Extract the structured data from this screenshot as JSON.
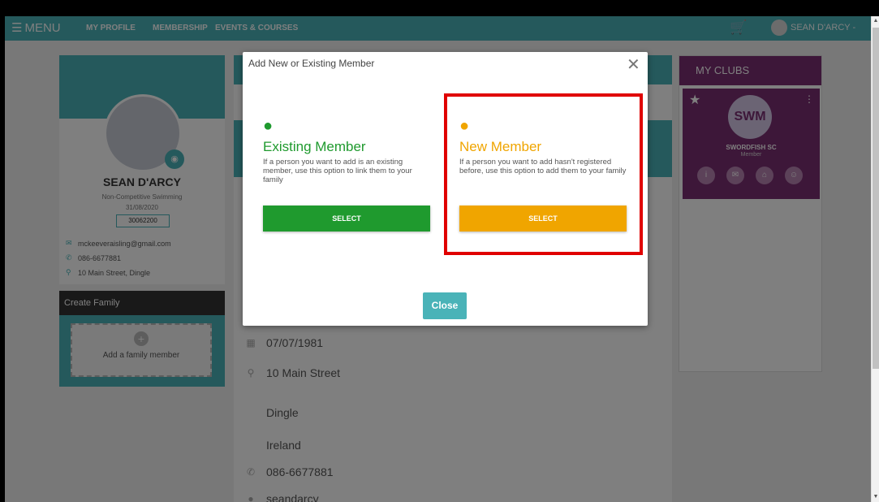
{
  "topbar": {
    "menu_label": "MENU",
    "nav": [
      "MY PROFILE",
      "MEMBERSHIP",
      "EVENTS & COURSES"
    ],
    "user_name": "SEAN D'ARCY -"
  },
  "profile": {
    "name": "SEAN D'ARCY",
    "category": "Non-Competitive Swimming",
    "date": "31/08/2020",
    "member_id": "30062200",
    "email": "mckeeveraisling@gmail.com",
    "phone": "086-6677881",
    "address": "10 Main Street, Dingle"
  },
  "family": {
    "header": "Create Family",
    "add_label": "Add a family member"
  },
  "details": {
    "dob": "07/07/1981",
    "street": "10 Main Street",
    "town": "Dingle",
    "country": "Ireland",
    "phone": "086-6677881",
    "username": "seandarcy"
  },
  "clubs": {
    "header": "MY CLUBS",
    "logo_text": "SWM",
    "club_name": "SWORDFISH SC",
    "club_role": "Member"
  },
  "modal": {
    "title": "Add New or Existing Member",
    "existing": {
      "heading": "Existing Member",
      "description": "If a person you want to add is an existing member, use this option to link them to your family",
      "button": "SELECT"
    },
    "new": {
      "heading": "New Member",
      "description": "If a person you want to add hasn't registered before, use this option to add them to your family",
      "button": "SELECT"
    },
    "close_label": "Close"
  },
  "colors": {
    "teal": "#4ab3b8",
    "green": "#1f9a2e",
    "orange": "#f0a500",
    "purple": "#7b2f73",
    "highlight": "#e00000"
  }
}
